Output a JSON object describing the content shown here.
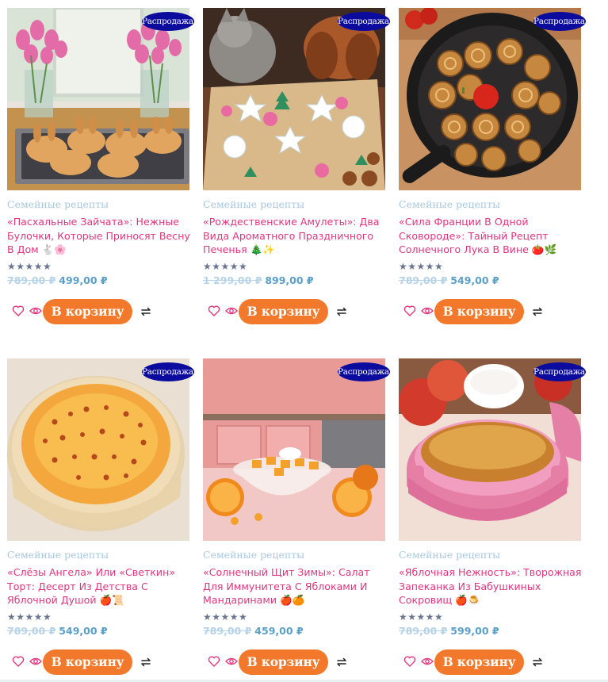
{
  "products": [
    {
      "sale_badge": "Распродажа!",
      "category": "Семейные рецепты",
      "title": "«Пасхальные Зайчата»: Нежные Булочки, Которые Приносят Весну В Дом 🐇🌸",
      "rating": 5,
      "old_price": "789,00 ₽",
      "new_price": "499,00 ₽",
      "cart_label": "В корзину",
      "image": "tulips-and-bunny-buns"
    },
    {
      "sale_badge": "Распродажа!",
      "category": "Семейные рецепты",
      "title": "«Рождественские Амулеты»: Два Вида Ароматного Праздничного Печенья 🎄✨",
      "rating": 5,
      "old_price": "1 299,00 ₽",
      "new_price": "899,00 ₽",
      "cart_label": "В корзину",
      "image": "cat-dog-christmas-cookies"
    },
    {
      "sale_badge": "Распродажа!",
      "category": "Семейные рецепты",
      "title": "«Сила Франции В Одной Сковороде»: Тайный Рецепт Солнечного Лука В Вине 🍅🌿",
      "rating": 5,
      "old_price": "789,00 ₽",
      "new_price": "549,00 ₽",
      "cart_label": "В корзину",
      "image": "caramelized-onions-skillet"
    },
    {
      "sale_badge": "Распродажа!",
      "category": "Семейные рецепты",
      "title": "«Слёзы Ангела» Или «Светкин» Торт: Десерт Из Детства С Яблочной Душой 🍎📜",
      "rating": 5,
      "old_price": "789,00 ₽",
      "new_price": "549,00 ₽",
      "cart_label": "В корзину",
      "image": "angel-tears-cake"
    },
    {
      "sale_badge": "Распродажа!",
      "category": "Семейные рецепты",
      "title": "«Солнечный Щит Зимы»: Салат Для Иммунитета С Яблоками И Мандаринами 🍎🍊",
      "rating": 5,
      "old_price": "789,00 ₽",
      "new_price": "459,00 ₽",
      "cart_label": "В корзину",
      "image": "apple-tangerine-salad"
    },
    {
      "sale_badge": "Распродажа!",
      "category": "Семейные рецепты",
      "title": "«Яблочная Нежность»: Творожная Запеканка Из Бабушкиных Сокровищ 🍎🍮",
      "rating": 5,
      "old_price": "789,00 ₽",
      "new_price": "599,00 ₽",
      "cart_label": "В корзину",
      "image": "apple-cottage-cheese-casserole"
    }
  ],
  "icons": {
    "wishlist": "heart-icon",
    "quick_view": "eye-icon",
    "compare": "compare-arrows-icon"
  },
  "colors": {
    "sale_badge": "#0b0b9e",
    "category": "#a8c8e0",
    "title": "#e0357f",
    "old_price": "#b5d3e8",
    "new_price": "#5a9fc8",
    "cart_button": "#f2792b",
    "stars": "#6a7690"
  }
}
